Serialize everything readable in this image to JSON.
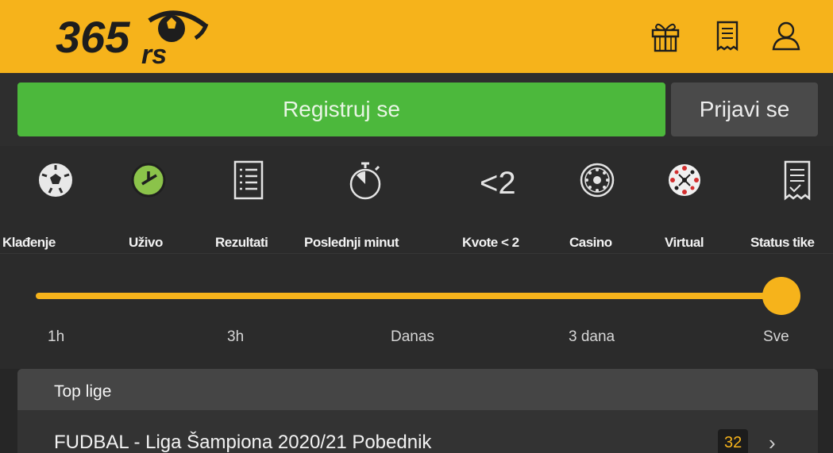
{
  "header": {
    "logo_text": "365rs",
    "icons": [
      "gift-icon",
      "ticket-icon",
      "user-icon"
    ],
    "color": "#f6b31b"
  },
  "auth": {
    "register_label": "Registruj se",
    "login_label": "Prijavi se",
    "register_color": "#4cb83c"
  },
  "nav": {
    "items": [
      {
        "label": "Klađenje",
        "icon": "soccer-ball-icon"
      },
      {
        "label": "Uživo",
        "icon": "clock-icon"
      },
      {
        "label": "Rezultati",
        "icon": "list-icon"
      },
      {
        "label": "Poslednji minut",
        "icon": "stopwatch-icon"
      },
      {
        "label": "Kvote < 2",
        "icon": "less-than-two-icon",
        "glyph": "<2"
      },
      {
        "label": "Casino",
        "icon": "roulette-icon"
      },
      {
        "label": "Virtual",
        "icon": "virtual-ball-icon"
      },
      {
        "label": "Status tike",
        "icon": "ticket-status-icon"
      }
    ]
  },
  "time_filter": {
    "ticks": [
      "1h",
      "3h",
      "Danas",
      "3 dana",
      "Sve"
    ],
    "selected": "Sve",
    "accent": "#f6b31b"
  },
  "leagues": {
    "title": "Top lige",
    "rows": [
      {
        "name": "FUDBAL - Liga Šampiona 2020/21 Pobednik",
        "count": "32"
      }
    ]
  }
}
